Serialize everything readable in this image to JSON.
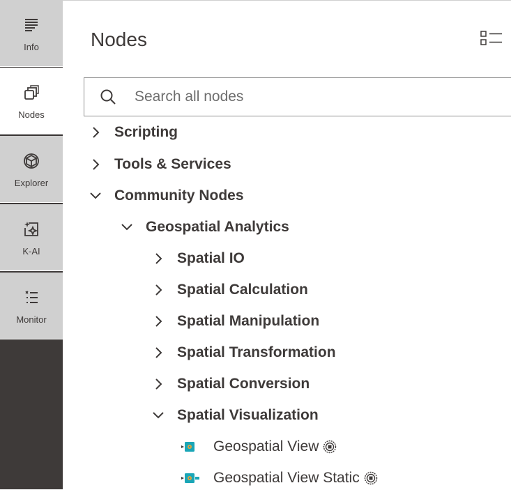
{
  "sidebar": {
    "tabs": [
      {
        "label": "Info",
        "icon": "info-lines-icon"
      },
      {
        "label": "Nodes",
        "icon": "nodes-stack-icon"
      },
      {
        "label": "Explorer",
        "icon": "cube-icon"
      },
      {
        "label": "K-AI",
        "icon": "sparkle-chat-icon"
      },
      {
        "label": "Monitor",
        "icon": "list-monitor-icon"
      }
    ],
    "active": "Nodes"
  },
  "panel": {
    "title": "Nodes",
    "search": {
      "placeholder": "Search all nodes",
      "value": ""
    }
  },
  "tree": {
    "items": [
      {
        "label": "Scripting",
        "expanded": false,
        "level": 0
      },
      {
        "label": "Tools & Services",
        "expanded": false,
        "level": 0
      },
      {
        "label": "Community Nodes",
        "expanded": true,
        "level": 0
      },
      {
        "label": "Geospatial Analytics",
        "expanded": true,
        "level": 1
      },
      {
        "label": "Spatial IO",
        "expanded": false,
        "level": 2
      },
      {
        "label": "Spatial Calculation",
        "expanded": false,
        "level": 2
      },
      {
        "label": "Spatial Manipulation",
        "expanded": false,
        "level": 2
      },
      {
        "label": "Spatial Transformation",
        "expanded": false,
        "level": 2
      },
      {
        "label": "Spatial Conversion",
        "expanded": false,
        "level": 2
      },
      {
        "label": "Spatial Visualization",
        "expanded": true,
        "level": 2
      }
    ],
    "nodes": [
      {
        "label": "Geospatial View",
        "icon": "visualizer-node-icon",
        "badge": "community-node-icon"
      },
      {
        "label": "Geospatial View Static",
        "icon": "visualizer-node-icon",
        "badge": "community-node-icon"
      }
    ]
  },
  "colors": {
    "rail_dark": "#3e3a39",
    "tab_gray": "#d0d0d0",
    "node_teal": "#1aa6b7",
    "node_orange": "#e8a33a",
    "text": "#3e3a39"
  }
}
